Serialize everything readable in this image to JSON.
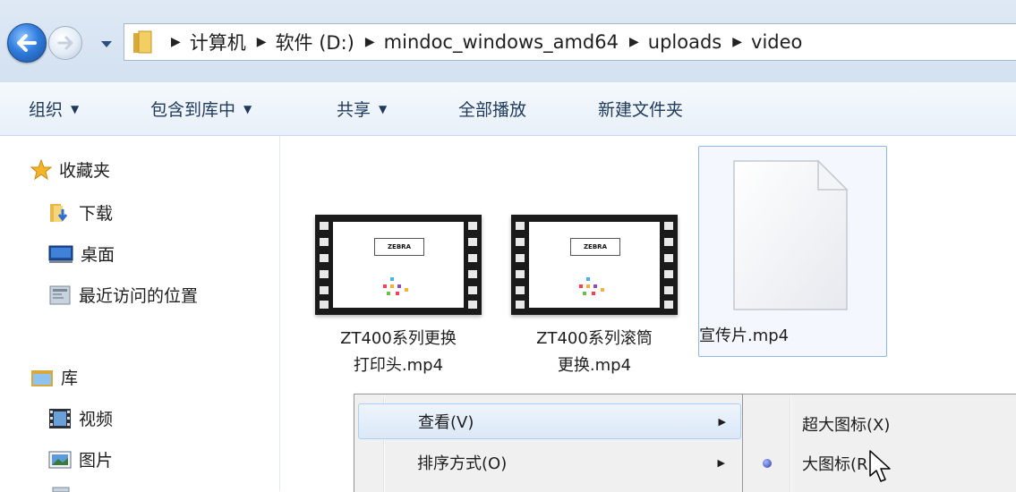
{
  "address_bar": {
    "crumbs": [
      "计算机",
      "软件 (D:)",
      "mindoc_windows_amd64",
      "uploads",
      "video"
    ]
  },
  "toolbar": {
    "organize": "组织",
    "include_library": "包含到库中",
    "share": "共享",
    "play_all": "全部播放",
    "new_folder": "新建文件夹"
  },
  "nav": {
    "favorites": "收藏夹",
    "downloads": "下载",
    "desktop": "桌面",
    "recent": "最近访问的位置",
    "libraries": "库",
    "videos": "视频",
    "pictures": "图片"
  },
  "files": [
    {
      "name_line1": "ZT400系列更换",
      "name_line2": "打印头.mp4",
      "icon": "video-thumbnail",
      "logo_text": "ZEBRA"
    },
    {
      "name_line1": "ZT400系列滚筒",
      "name_line2": "更换.mp4",
      "icon": "video-thumbnail",
      "logo_text": "ZEBRA"
    },
    {
      "name_line1": "宣传片.mp4",
      "icon": "blank-document-icon",
      "selected": true
    }
  ],
  "context_menu": {
    "view": "查看(V)",
    "sort": "排序方式(O)"
  },
  "submenu": {
    "extra_large": "超大图标(X)",
    "large": "大图标(R)",
    "checked": "large"
  },
  "colors": {
    "toolbar_text": "#1e395b",
    "selection_border": "#8fb8e8",
    "menu_highlight": "#dae8f8"
  }
}
